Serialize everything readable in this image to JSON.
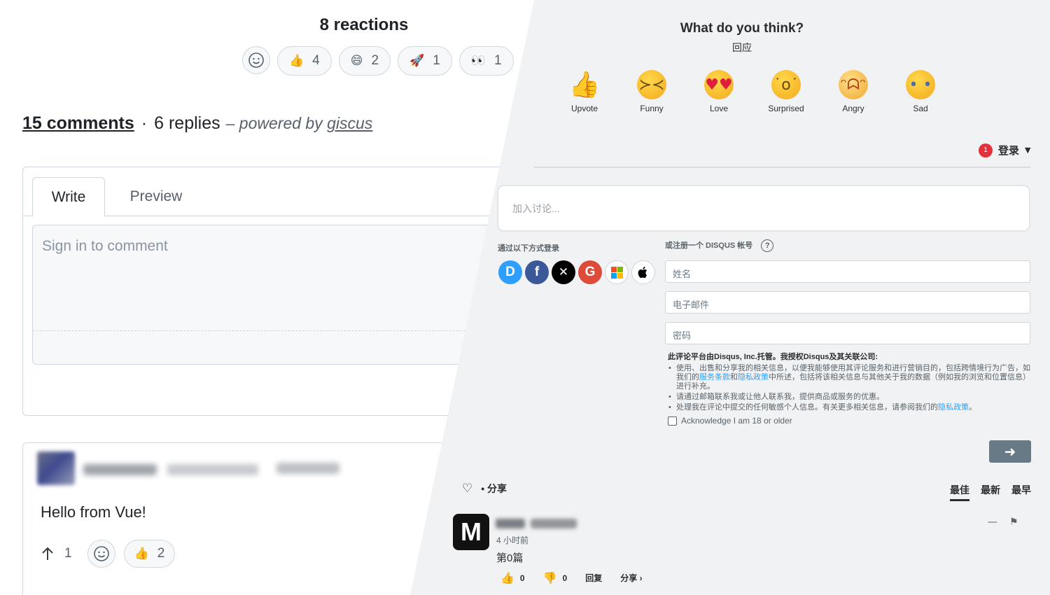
{
  "giscus": {
    "reactions_title": "8 reactions",
    "reactions": [
      {
        "emoji": "👍",
        "count": "4",
        "icon": "thumbs-up-icon"
      },
      {
        "emoji": "😄",
        "count": "2",
        "icon": "laugh-icon"
      },
      {
        "emoji": "🚀",
        "count": "1",
        "icon": "rocket-icon"
      },
      {
        "emoji": "👀",
        "count": "1",
        "icon": "eyes-icon"
      }
    ],
    "comments_count": "15 comments",
    "separator": "·",
    "replies_count": "6 replies",
    "powered_prefix": "– powered by",
    "powered_link": "giscus",
    "tabs": {
      "write": "Write",
      "preview": "Preview"
    },
    "comment_placeholder": "Sign in to comment",
    "comment": {
      "text": "Hello from Vue!",
      "upvotes": "1",
      "thumbs_count": "2"
    }
  },
  "disqus": {
    "title": "What do you think?",
    "subtitle": "回应",
    "reactions": [
      {
        "label": "Upvote",
        "icon": "upvote-face-icon"
      },
      {
        "label": "Funny",
        "icon": "funny-face-icon"
      },
      {
        "label": "Love",
        "icon": "love-face-icon"
      },
      {
        "label": "Surprised",
        "icon": "surprised-face-icon"
      },
      {
        "label": "Angry",
        "icon": "angry-face-icon"
      },
      {
        "label": "Sad",
        "icon": "sad-face-icon"
      }
    ],
    "notification_count": "1",
    "login_label": "登录",
    "discussion_placeholder": "加入讨论...",
    "login_with_label": "通过以下方式登录",
    "register_label": "或注册一个 DISQUS 帐号",
    "help_symbol": "?",
    "fields": {
      "name": "姓名",
      "email": "电子邮件",
      "password": "密码"
    },
    "terms": {
      "head": "此评论平台由Disqus, Inc.托管。我授权Disqus及其关联公司:",
      "item1_a": "使用、出售和分享我的相关信息，以便我能够使用其评论服务和进行营销目的，包括跨情境行为广告，如我们的",
      "item1_link1": "服务条款",
      "item1_and": "和",
      "item1_link2": "隐私政策",
      "item1_b": "中所述，包括将该相关信息与其他关于我的数据（例如我的浏览和位置信息）进行补充。",
      "item2": "请通过邮箱联系我或让他人联系我，提供商品或服务的优惠。",
      "item3_a": "处理我在评论中提交的任何敏感个人信息。有关更多相关信息，请参阅我们的",
      "item3_link": "隐私政策",
      "item3_b": "。"
    },
    "acknowledge": "Acknowledge I am 18 or older",
    "share_label": "• 分享",
    "sort": {
      "best": "最佳",
      "newest": "最新",
      "oldest": "最早"
    },
    "comment": {
      "avatar_letter": "M",
      "time": "4 小时前",
      "text": "第0篇",
      "likes": "0",
      "dislikes": "0",
      "reply": "回复",
      "share": "分享 ›"
    },
    "colors": {
      "accent": "#2e9fff",
      "badge": "#e3323c",
      "submit": "#687a86"
    }
  }
}
